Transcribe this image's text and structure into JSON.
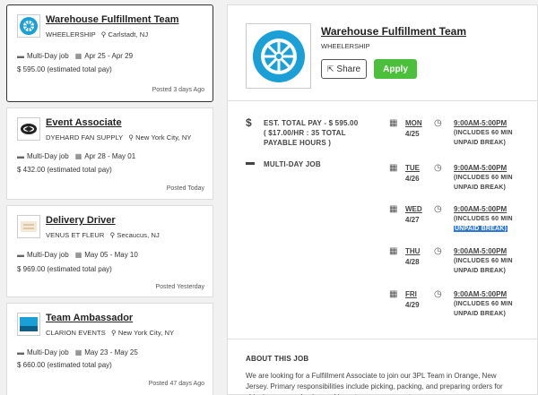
{
  "jobs": [
    {
      "title": "Warehouse Fulfillment Team",
      "company": "WHEELERSHIP",
      "location": "Carlstadt, NJ",
      "job_type": "Multi-Day job",
      "dates": "Apr 25 - Apr 29",
      "pay": "$ 595.00 (estimated total pay)",
      "posted": "Posted 3 days Ago",
      "logo": "wheel-icon"
    },
    {
      "title": "Event Associate",
      "company": "DYEHARD FAN SUPPLY",
      "location": "New York City, NY",
      "job_type": "Multi-Day job",
      "dates": "Apr 28 - May 01",
      "pay": "$ 432.00 (estimated total pay)",
      "posted": "Posted Today",
      "logo": "dyehard-logo"
    },
    {
      "title": "Delivery Driver",
      "company": "VENUS ET FLEUR",
      "location": "Secaucus, NJ",
      "job_type": "Multi-Day job",
      "dates": "May 05 - May 10",
      "pay": "$ 969.00 (estimated total pay)",
      "posted": "Posted Yesterday",
      "logo": "venus-et-fleur-logo"
    },
    {
      "title": "Team Ambassador",
      "company": "CLARION EVENTS",
      "location": "New York City, NY",
      "job_type": "Multi-Day job",
      "dates": "May 23 - May 25",
      "pay": "$ 660.00 (estimated total pay)",
      "posted": "Posted 47 days Ago",
      "logo": "clarion-logo"
    }
  ],
  "detail": {
    "title": "Warehouse Fulfillment Team",
    "company": "WHEELERSHIP",
    "share_label": "Share",
    "apply_label": "Apply",
    "pay_line1": "EST. TOTAL PAY - $ 595.00",
    "pay_line2": "( $17.00/HR : 35 TOTAL PAYABLE HOURS )",
    "job_type": "MULTI-DAY JOB",
    "schedule": [
      {
        "day": "MON",
        "date": "4/25",
        "time": "9:00AM-5:00PM",
        "break1": "(INCLUDES 60 MIN",
        "break2": "UNPAID BREAK)"
      },
      {
        "day": "TUE",
        "date": "4/26",
        "time": "9:00AM-5:00PM",
        "break1": "(INCLUDES 60 MIN",
        "break2": "UNPAID BREAK)"
      },
      {
        "day": "WED",
        "date": "4/27",
        "time": "9:00AM-5:00PM",
        "break1": "(INCLUDES 60 MIN",
        "break2": "UNPAID BREAK)"
      },
      {
        "day": "THU",
        "date": "4/28",
        "time": "9:00AM-5:00PM",
        "break1": "(INCLUDES 60 MIN",
        "break2": "UNPAID BREAK)"
      },
      {
        "day": "FRI",
        "date": "4/29",
        "time": "9:00AM-5:00PM",
        "break1": "(INCLUDES 60 MIN",
        "break2": "UNPAID BREAK)"
      }
    ],
    "about_heading": "ABOUT THIS JOB",
    "about_text": "We are looking for a Fulfillment Associate to join our 3PL Team in Orange, New Jersey. Primary responsibilities include picking, packing, and preparing orders for shipping, pre-packaging and inventory management, some"
  },
  "colors": {
    "accent_green": "#4cbf3c",
    "wheel_blue": "#1a9fd6",
    "selection_blue": "#2f78d8"
  }
}
